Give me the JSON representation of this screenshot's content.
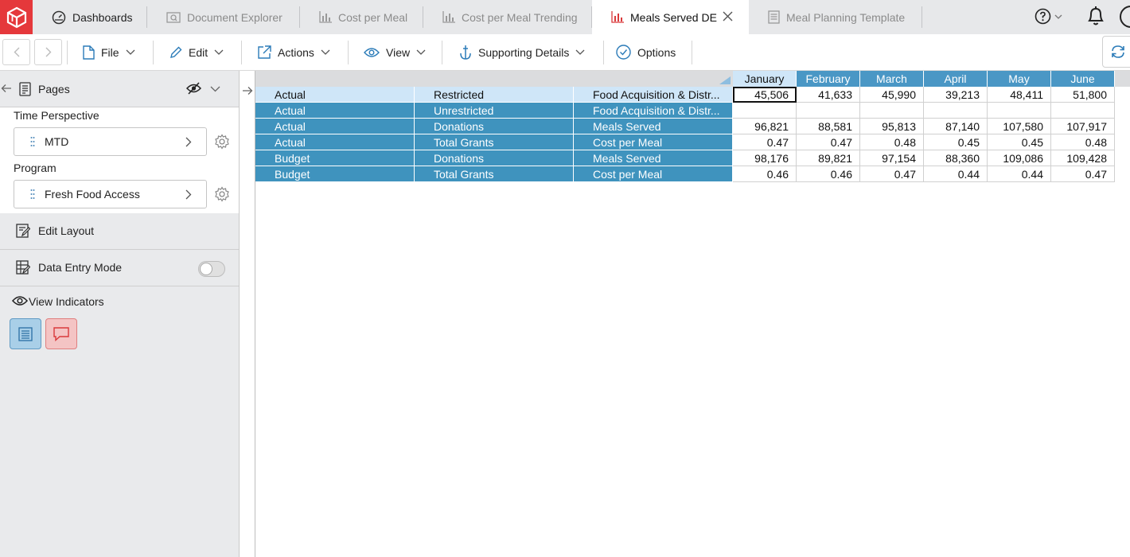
{
  "tabs": [
    {
      "label": "Dashboards",
      "icon": "dashboard-icon"
    },
    {
      "label": "Document Explorer",
      "icon": "document-search-icon"
    },
    {
      "label": "Cost per Meal",
      "icon": "bar-chart-icon"
    },
    {
      "label": "Cost per Meal Trending",
      "icon": "bar-chart-icon"
    },
    {
      "label": "Meals Served DE",
      "icon": "bar-chart-icon"
    },
    {
      "label": "Meal Planning Template",
      "icon": "sheet-icon"
    }
  ],
  "toolbar": {
    "file": "File",
    "edit": "Edit",
    "actions": "Actions",
    "view": "View",
    "supporting_details": "Supporting Details",
    "options": "Options"
  },
  "left_panel": {
    "pages_label": "Pages",
    "time_perspective_label": "Time Perspective",
    "time_perspective_value": "MTD",
    "program_label": "Program",
    "program_value": "Fresh Food Access",
    "edit_layout": "Edit Layout",
    "data_entry_mode": "Data Entry Mode",
    "data_entry_mode_on": false,
    "view_indicators": "View Indicators"
  },
  "grid": {
    "months": [
      "January",
      "February",
      "March",
      "April",
      "May",
      "June"
    ],
    "rows": [
      {
        "scenario": "Actual",
        "fund": "Restricted",
        "measure": "Food Acquisition & Distr...",
        "values": [
          "45,506",
          "41,633",
          "45,990",
          "39,213",
          "48,411",
          "51,800"
        ]
      },
      {
        "scenario": "Actual",
        "fund": "Unrestricted",
        "measure": "Food Acquisition & Distr...",
        "values": [
          "",
          "",
          "",
          "",
          "",
          ""
        ]
      },
      {
        "scenario": "Actual",
        "fund": "Donations",
        "measure": "Meals Served",
        "values": [
          "96,821",
          "88,581",
          "95,813",
          "87,140",
          "107,580",
          "107,917"
        ]
      },
      {
        "scenario": "Actual",
        "fund": "Total Grants",
        "measure": "Cost per Meal",
        "values": [
          "0.47",
          "0.47",
          "0.48",
          "0.45",
          "0.45",
          "0.48"
        ]
      },
      {
        "scenario": "Budget",
        "fund": "Donations",
        "measure": "Meals Served",
        "values": [
          "98,176",
          "89,821",
          "97,154",
          "88,360",
          "109,086",
          "109,428"
        ]
      },
      {
        "scenario": "Budget",
        "fund": "Total Grants",
        "measure": "Cost per Meal",
        "values": [
          "0.46",
          "0.46",
          "0.47",
          "0.44",
          "0.44",
          "0.47"
        ]
      }
    ]
  },
  "colors": {
    "brand": "#e5383b",
    "dimension_cell": "#3f93be",
    "header_cell": "#4a97c5",
    "selected_cell": "#cfe6f8"
  }
}
